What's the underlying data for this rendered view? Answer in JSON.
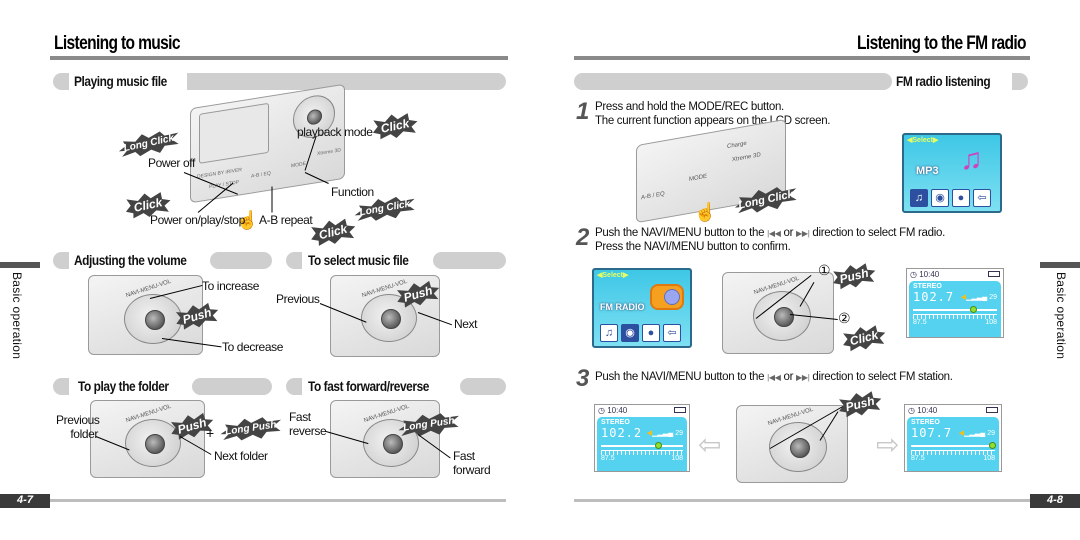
{
  "left_page": {
    "title": "Listening to music",
    "sections": {
      "playing": {
        "heading": "Playing music file",
        "labels": {
          "power_off": "Power off",
          "power_on": "Power on/play/stop",
          "ab_repeat": "A-B repeat",
          "function": "Function",
          "playback_mode": "playback mode"
        },
        "device_labels": {
          "play_stop": "PLAY / STOP",
          "ab_eq": "A-B / EQ",
          "mode": "MODE",
          "xtreme": "Xtreme 3D",
          "design": "DESIGN BY iRIVER"
        },
        "bursts": {
          "long_click_1": "Long Click",
          "click_1": "Click",
          "click_2": "Click",
          "long_click_2": "Long Click",
          "click_3": "Click"
        }
      },
      "volume": {
        "heading": "Adjusting the volume",
        "labels": {
          "increase": "To increase",
          "decrease": "To decrease"
        },
        "burst": "Push",
        "wheel_label": "NAVI-MENU-VOL"
      },
      "select_file": {
        "heading": "To select music file",
        "labels": {
          "previous": "Previous",
          "next": "Next"
        },
        "burst": "Push",
        "wheel_label": "NAVI-MENU-VOL"
      },
      "folder": {
        "heading": "To play the  folder",
        "labels": {
          "previous_folder_1": "Previous",
          "previous_folder_2": "folder",
          "next_folder": "Next folder",
          "plus": "+"
        },
        "bursts": {
          "push": "Push",
          "long_push": "Long Push"
        },
        "wheel_label": "NAVI-MENU-VOL"
      },
      "ffrev": {
        "heading": "To fast forward/reverse",
        "labels": {
          "fast_reverse_1": "Fast",
          "fast_reverse_2": "reverse",
          "fast_forward_1": "Fast",
          "fast_forward_2": "forward"
        },
        "burst": "Long Push",
        "wheel_label": "NAVI-MENU-VOL"
      }
    },
    "side_tab": "Basic operation",
    "page_number": "4-7"
  },
  "right_page": {
    "title": "Listening to the FM radio",
    "section_heading": "FM radio listening",
    "steps": [
      {
        "num": "1",
        "lines": [
          "Press and hold the MODE/REC button.",
          "The current function appears on the LCD screen."
        ]
      },
      {
        "num": "2",
        "line1_a": "Push the NAVI/MENU button to the",
        "prev_sym": "|◀◀",
        "or": "or",
        "next_sym": "▶▶|",
        "line1_b": "direction to select FM radio.",
        "line2": "Press the NAVI/MENU button to confirm."
      },
      {
        "num": "3",
        "line1_a": "Push the NAVI/MENU button to the",
        "prev_sym": "|◀◀",
        "or": "or",
        "next_sym": "▶▶|",
        "line1_b": "direction to select FM station."
      }
    ],
    "step1_device": {
      "charge": "Charge",
      "xtreme": "Xtreme 3D",
      "mode": "MODE",
      "ab_eq": "A-B / EQ",
      "burst": "Long Click"
    },
    "mp3_screen": {
      "select": "Select",
      "label": "MP3"
    },
    "fm_menu_screen": {
      "select": "Select",
      "label": "FM RADIO"
    },
    "step2_wheel": {
      "marker1": "①",
      "marker2": "②",
      "burst_push": "Push",
      "burst_click": "Click",
      "wheel_label": "NAVI-MENU-VOL"
    },
    "step3_wheel": {
      "burst_push": "Push",
      "wheel_label": "NAVI-MENU-VOL"
    },
    "radio_screens": [
      {
        "time": "10:40",
        "mode": "STEREO",
        "freq": "102.7",
        "volume": "29",
        "range_min": "87.5",
        "range_max": "108",
        "tuner_position": 0.73
      },
      {
        "time": "10:40",
        "mode": "STEREO",
        "freq": "102.2",
        "volume": "29",
        "range_min": "87.5",
        "range_max": "108",
        "tuner_position": 0.71
      },
      {
        "time": "10:40",
        "mode": "STEREO",
        "freq": "107.7",
        "volume": "29",
        "range_min": "87.5",
        "range_max": "108",
        "tuner_position": 0.98
      }
    ],
    "side_tab": "Basic operation",
    "page_number": "4-8"
  }
}
